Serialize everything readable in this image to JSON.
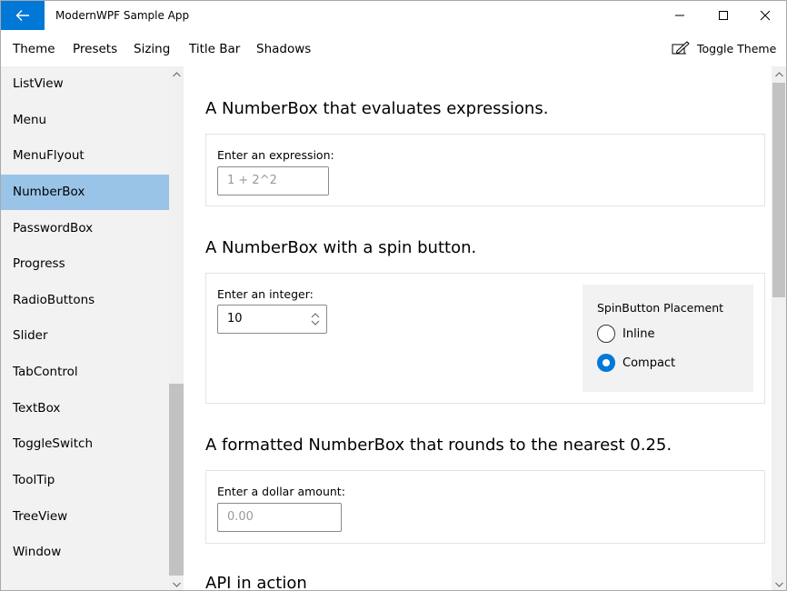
{
  "window": {
    "title": "ModernWPF Sample App"
  },
  "menu": {
    "items": [
      "Theme",
      "Presets",
      "Sizing",
      "Title Bar",
      "Shadows"
    ],
    "toggle_theme": "Toggle Theme"
  },
  "sidebar": {
    "items": [
      {
        "label": "ListView"
      },
      {
        "label": "Menu"
      },
      {
        "label": "MenuFlyout"
      },
      {
        "label": "NumberBox",
        "selected": true
      },
      {
        "label": "PasswordBox"
      },
      {
        "label": "Progress"
      },
      {
        "label": "RadioButtons"
      },
      {
        "label": "Slider"
      },
      {
        "label": "TabControl"
      },
      {
        "label": "TextBox"
      },
      {
        "label": "ToggleSwitch"
      },
      {
        "label": "ToolTip"
      },
      {
        "label": "TreeView"
      },
      {
        "label": "Window"
      }
    ]
  },
  "sections": {
    "expression": {
      "title": "A NumberBox that evaluates expressions.",
      "label": "Enter an expression:",
      "placeholder": "1 + 2^2"
    },
    "spin": {
      "title": "A NumberBox with a spin button.",
      "label": "Enter an integer:",
      "value": "10",
      "options_header": "SpinButton Placement",
      "options": [
        {
          "label": "Inline",
          "checked": false
        },
        {
          "label": "Compact",
          "checked": true
        }
      ]
    },
    "formatted": {
      "title": "A formatted NumberBox that rounds to the nearest 0.25.",
      "label": "Enter a dollar amount:",
      "placeholder": "0.00"
    },
    "api": {
      "title": "API in action"
    }
  },
  "colors": {
    "accent": "#0078d7",
    "selected_nav": "#99c4e8",
    "sidebar_bg": "#f2f2f2"
  },
  "icons": {
    "back": "arrow-left-icon",
    "minimize": "minimize-icon",
    "maximize": "maximize-icon",
    "close": "close-icon",
    "toggle_theme": "theme-pen-icon",
    "spin": "spin-chevrons-icon"
  }
}
